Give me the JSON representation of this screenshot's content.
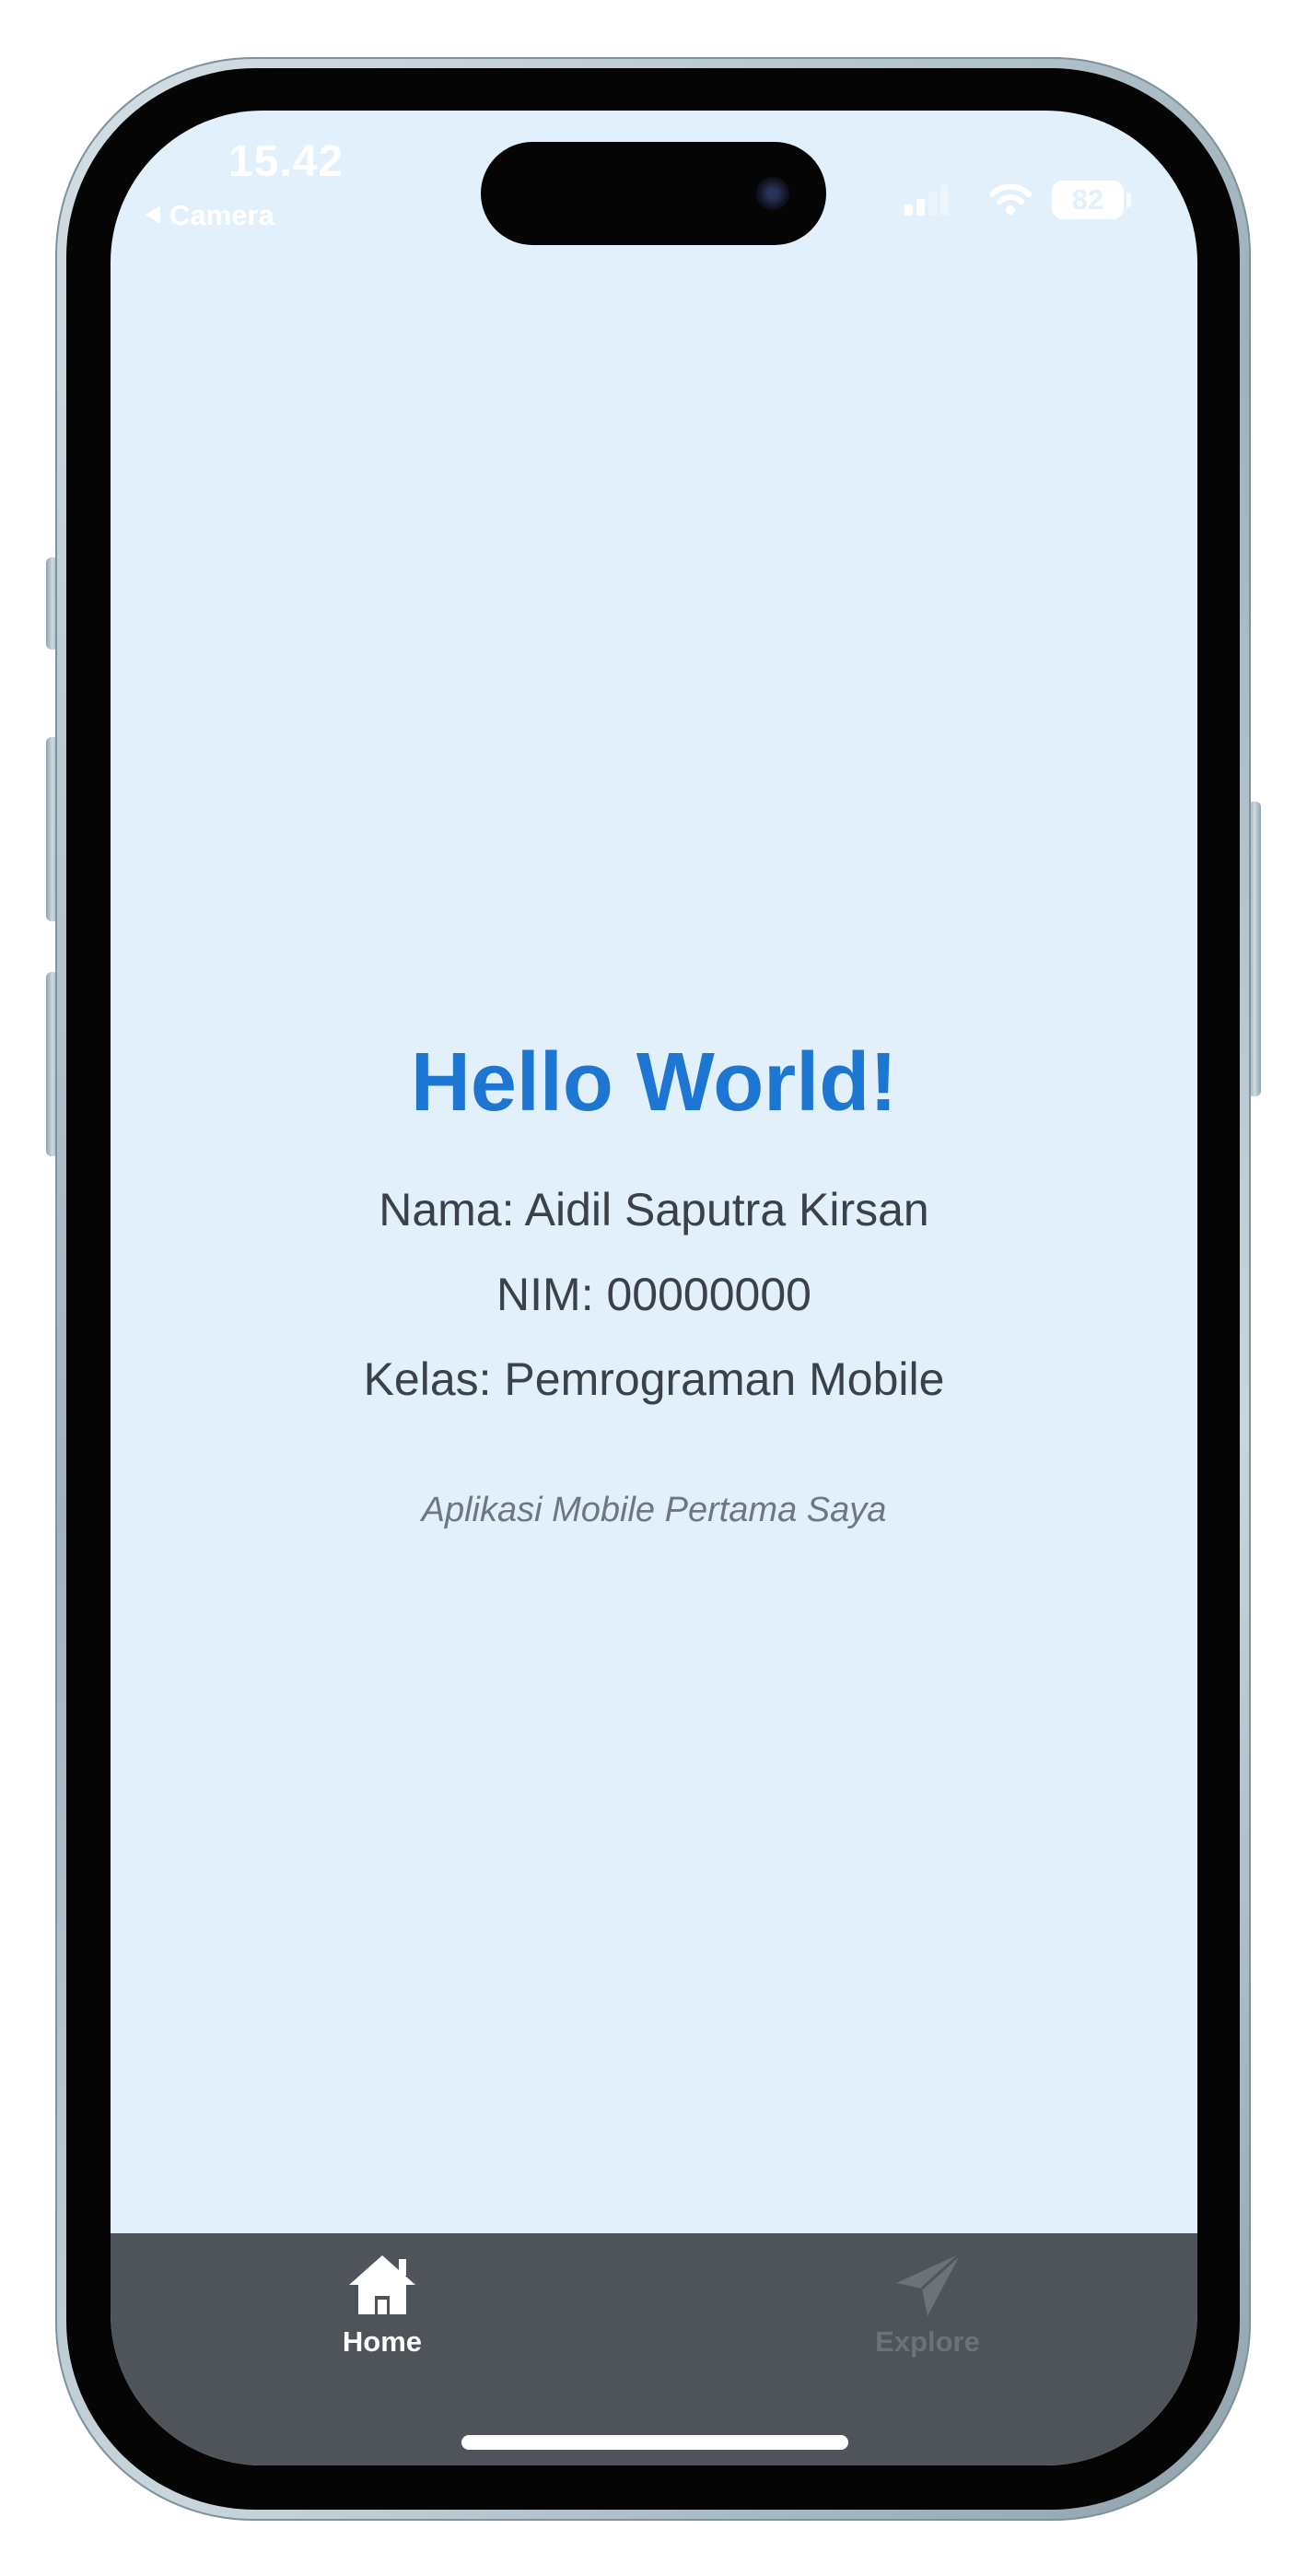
{
  "status_bar": {
    "time": "15.42",
    "back_app": "Camera",
    "battery": "82",
    "signal_icon": "signal-icon",
    "wifi_icon": "wifi-icon"
  },
  "main": {
    "title": "Hello World!",
    "nama": "Nama: Aidil Saputra Kirsan",
    "nim": "NIM: 00000000",
    "kelas": "Kelas: Pemrograman Mobile",
    "tagline": "Aplikasi Mobile Pertama Saya"
  },
  "tabbar": {
    "tabs": [
      {
        "label": "Home",
        "icon": "home-icon",
        "active": true
      },
      {
        "label": "Explore",
        "icon": "paper-plane-icon",
        "active": false
      }
    ]
  },
  "colors": {
    "background": "#e2f0fb",
    "title": "#1e76d3",
    "tabbar": "#4f545a",
    "tab_active": "#ffffff",
    "tab_inactive": "#6c7279"
  }
}
